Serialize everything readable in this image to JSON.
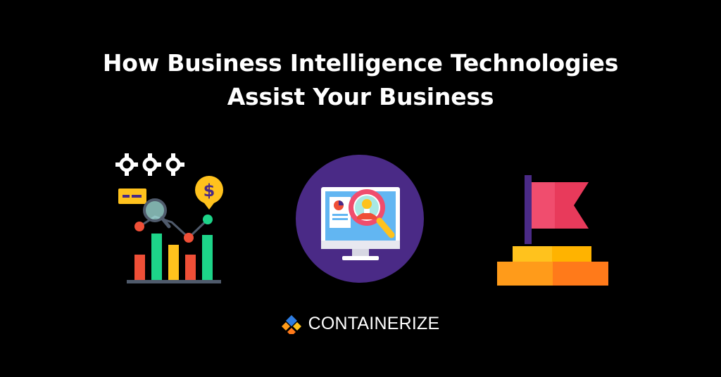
{
  "heading": {
    "line1": "How Business Intelligence Technologies",
    "line2": "Assist Your Business"
  },
  "icons": {
    "left": "analytics-chart-icon",
    "center": "monitor-search-user-icon",
    "right": "flag-podium-icon"
  },
  "brand": {
    "name": "CONTAINERIZE",
    "logo": "containerize-logo"
  },
  "colors": {
    "background": "#000000",
    "text": "#ffffff",
    "purple_circle": "#4a2a86",
    "orange": "#ff7a1a",
    "yellow": "#ffc21d",
    "green": "#1dd489",
    "red": "#ef4f37",
    "pink_flag": "#f04d6e",
    "blue_logo": "#2f7de1"
  }
}
